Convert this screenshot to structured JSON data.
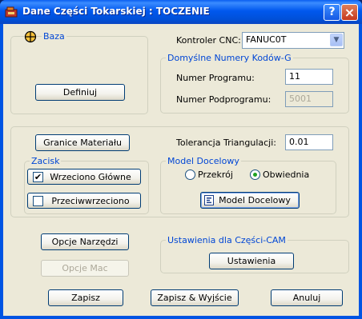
{
  "window": {
    "title": "Dane Części Tokarskiej : TOCZENIE",
    "help_glyph": "?",
    "close_glyph": "×"
  },
  "base": {
    "title": "Baza",
    "define_button": "Definiuj"
  },
  "cnc": {
    "label": "Kontroler CNC:",
    "value": "FANUC0T"
  },
  "codes": {
    "title": "Domyślne Numery Kodów-G",
    "program_label": "Numer Programu:",
    "program_value": "11",
    "subprogram_label": "Numer Podprogramu:",
    "subprogram_value": "5001"
  },
  "material": {
    "button": "Granice Materiału"
  },
  "triangulation": {
    "label": "Tolerancja Triangulacji:",
    "value": "0.01"
  },
  "clamp": {
    "title": "Zacisk",
    "main_spindle": "Wrzeciono Główne",
    "main_spindle_checked": true,
    "counter_spindle": "Przeciwwrzeciono",
    "counter_spindle_checked": false
  },
  "target_model": {
    "title": "Model Docelowy",
    "options": [
      "Przekrój",
      "Obwiednia"
    ],
    "selected": "Obwiednia",
    "button": "Model Docelowy"
  },
  "tools": {
    "tool_options": "Opcje Narzędzi",
    "mac_options": "Opcje Mac"
  },
  "cam": {
    "title": "Ustawienia dla Części-CAM",
    "button": "Ustawienia"
  },
  "footer": {
    "save": "Zapisz",
    "save_exit": "Zapisz & Wyjście",
    "cancel": "Anuluj"
  }
}
